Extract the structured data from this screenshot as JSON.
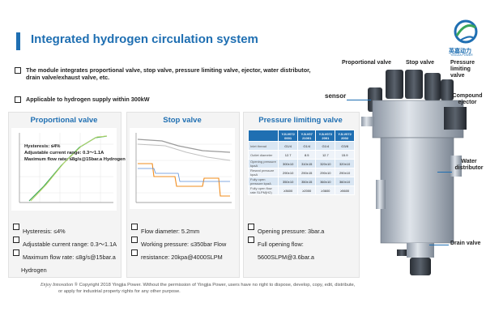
{
  "header": {
    "title": "Integrated hydrogen circulation system",
    "logo_cn": "英嘉动力",
    "logo_en": "YINGJIA POWER"
  },
  "bullets": [
    "The module integrates proportional valve, stop valve, pressure limiting valve, ejector, water distributor, drain valve/exhaust valve, etc.",
    "Applicable to hydrogen supply within 300kW"
  ],
  "panels": {
    "proportional": {
      "title": "Proportional valve",
      "chart_overlay": {
        "line1": "Hysteresis: ≤4%",
        "line2": "Adjustable current range: 0.3～1.1A",
        "line3": "Maximum flow rate: ≤8g/s@15bar.a Hydrogen"
      },
      "specs": [
        "Hysteresis: ≤4%",
        "Adjustable current range: 0.3～1.1A",
        "Maximum flow rate: ≤8g/s@15bar.a",
        "Hydrogen"
      ]
    },
    "stop": {
      "title": "Stop valve",
      "specs": [
        "Flow diameter: 5.2mm",
        "Working pressure: ≤350bar Flow",
        "resistance: 20kpa@4000SLPM"
      ]
    },
    "pressure": {
      "title": "Pressure limiting valve",
      "table": {
        "headers": [
          "",
          "YJLV072 0001",
          "YJLV07 21001",
          "YJLV072 2001",
          "YJLV072 2002"
        ],
        "rows": [
          [
            "Inlet thread",
            "G1/4",
            "G1/4",
            "G1/4",
            "G3/8"
          ],
          [
            "Outlet diameter",
            "12.7",
            "8.5",
            "12.7",
            "15.9"
          ],
          [
            "Opening pressure kpaA",
            "300±10",
            "310±15",
            "320±10",
            "320±10"
          ],
          [
            "Reseat pressure kpaA",
            "290±10",
            "290±15",
            "290±10",
            "290±10"
          ],
          [
            "Fully open pressure kpaA",
            "350±10",
            "350±15",
            "360±10",
            "360±10"
          ],
          [
            "Fully open flow rate SLPM(H2)",
            "≥3600",
            "≥2000",
            "≥3600",
            "≥5600"
          ]
        ]
      },
      "specs": [
        "Opening pressure: 3bar.a",
        "Full opening flow:",
        "5600SLPM@3.6bar.a"
      ]
    }
  },
  "product_labels": {
    "proportional": "Proportional valve",
    "stop": "Stop valve",
    "pressure": "Pressure limiting valve",
    "sensor": "sensor",
    "compound": "Compound ejector",
    "water": "Water distributor",
    "drain": "Drain valve"
  },
  "footer": {
    "brand": "Enjoy Innovation ®",
    "line1": " Copyright 2018 Yingjia Power. Without the permission of Yingjia Power, users have no right to dispose, develop, copy, edit, distribute,",
    "line2": "or apply for industrial property rights for any other purpose."
  },
  "colors": {
    "accent": "#1f6fb2",
    "curve_green": "#3aa55a",
    "curve_orange": "#f08c1e",
    "curve_gray": "#9a9a9a"
  }
}
